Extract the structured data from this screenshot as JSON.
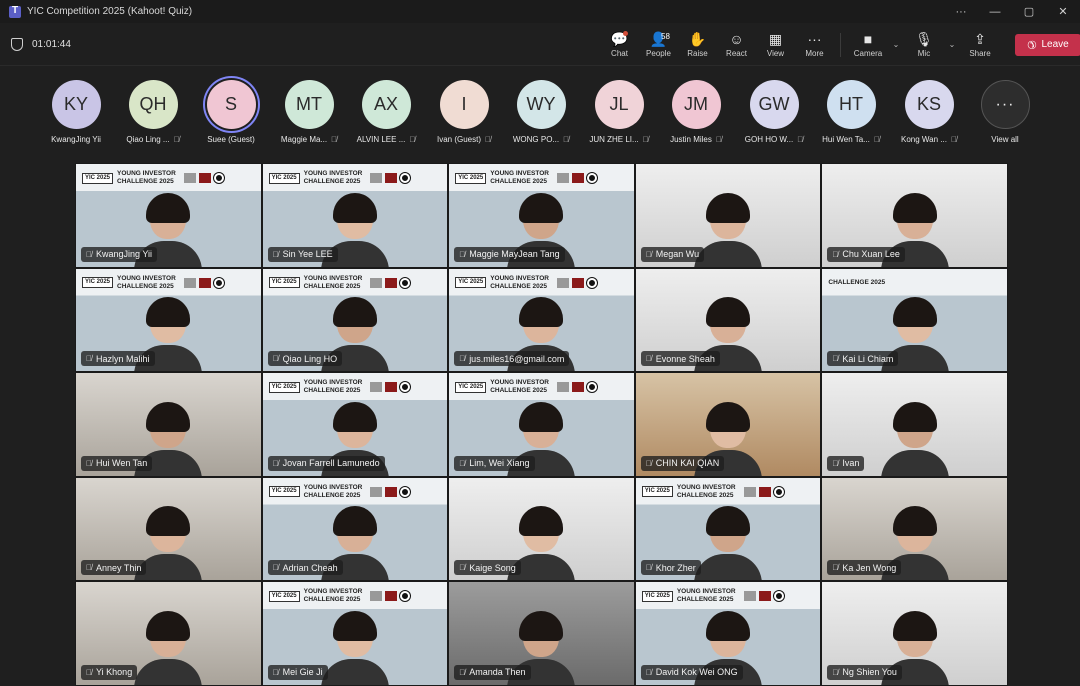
{
  "window": {
    "title": "YIC Competition 2025 (Kahoot! Quiz)",
    "controls": [
      "···",
      "—",
      "▢",
      "✕"
    ]
  },
  "toolbar": {
    "timer": "01:01:44",
    "chat_label": "Chat",
    "people_label": "People",
    "people_count": "58",
    "raise_label": "Raise",
    "react_label": "React",
    "view_label": "View",
    "more_label": "More",
    "camera_label": "Camera",
    "mic_label": "Mic",
    "share_label": "Share",
    "leave_label": "Leave"
  },
  "participants": [
    {
      "initials": "KY",
      "name": "KwangJing Yii",
      "color": "#c9c5e6",
      "muted": false
    },
    {
      "initials": "QH",
      "name": "Qiao Ling ...",
      "color": "#d9e6c8",
      "muted": true
    },
    {
      "initials": "S",
      "name": "Suee (Guest)",
      "color": "#f0c6d3",
      "muted": false,
      "speaking": true
    },
    {
      "initials": "MT",
      "name": "Maggie Ma...",
      "color": "#cfe8d8",
      "muted": true
    },
    {
      "initials": "AX",
      "name": "ALVIN LEE ...",
      "color": "#cfe8d8",
      "muted": true
    },
    {
      "initials": "I",
      "name": "Ivan (Guest)",
      "color": "#f0dcd3",
      "muted": true
    },
    {
      "initials": "WY",
      "name": "WONG PO...",
      "color": "#d3e6e8",
      "muted": true
    },
    {
      "initials": "JL",
      "name": "JUN ZHE LI...",
      "color": "#f0d3d8",
      "muted": true
    },
    {
      "initials": "JM",
      "name": "Justin Miles",
      "color": "#f0c6d3",
      "muted": true
    },
    {
      "initials": "GW",
      "name": "GOH HO W...",
      "color": "#d8d8ee",
      "muted": true
    },
    {
      "initials": "HT",
      "name": "Hui Wen Ta...",
      "color": "#cfe0f0",
      "muted": true
    },
    {
      "initials": "KS",
      "name": "Kong Wan ...",
      "color": "#d8d8ee",
      "muted": true
    }
  ],
  "view_all_label": "View all",
  "banner": {
    "yic": "YIC 2025",
    "line1": "YOUNG INVESTOR",
    "line2": "CHALLENGE 2025",
    "alt": "CHALLENGE 2025"
  },
  "tiles": [
    {
      "name": "KwangJing Yii",
      "bg": "bg-banner",
      "banner": true
    },
    {
      "name": "Sin Yee LEE",
      "bg": "bg-banner",
      "banner": true
    },
    {
      "name": "Maggie MayJean Tang",
      "bg": "bg-banner",
      "banner": true
    },
    {
      "name": "Megan Wu",
      "bg": "bg-white",
      "banner": false
    },
    {
      "name": "Chu Xuan Lee",
      "bg": "bg-white",
      "banner": false
    },
    {
      "name": "Hazlyn Malihi",
      "bg": "bg-banner",
      "banner": true
    },
    {
      "name": "Qiao Ling HO",
      "bg": "bg-banner",
      "banner": true
    },
    {
      "name": "jus.miles16@gmail.com",
      "bg": "bg-banner",
      "banner": true
    },
    {
      "name": "Evonne Sheah",
      "bg": "bg-white",
      "banner": false
    },
    {
      "name": "Kai Li Chiam",
      "bg": "bg-banner",
      "banner": false,
      "alt_banner": true
    },
    {
      "name": "Hui Wen Tan",
      "bg": "bg-room",
      "banner": false
    },
    {
      "name": "Jovan Farrell Lamunedo",
      "bg": "bg-banner",
      "banner": true
    },
    {
      "name": "Lim, Wei Xiang",
      "bg": "bg-banner",
      "banner": true
    },
    {
      "name": "CHIN KAI QIAN",
      "bg": "bg-warm",
      "banner": false
    },
    {
      "name": "Ivan",
      "bg": "bg-white",
      "banner": false
    },
    {
      "name": "Anney Thin",
      "bg": "bg-room",
      "banner": false
    },
    {
      "name": "Adrian Cheah",
      "bg": "bg-banner",
      "banner": true
    },
    {
      "name": "Kaige Song",
      "bg": "bg-white",
      "banner": false
    },
    {
      "name": "Khor Zher",
      "bg": "bg-banner",
      "banner": true
    },
    {
      "name": "Ka Jen Wong",
      "bg": "bg-room",
      "banner": false
    },
    {
      "name": "Yi Khong",
      "bg": "bg-room",
      "banner": false
    },
    {
      "name": "Mei Gie Ji",
      "bg": "bg-banner",
      "banner": true
    },
    {
      "name": "Amanda Then",
      "bg": "bg-dark",
      "banner": false
    },
    {
      "name": "David Kok Wei ONG",
      "bg": "bg-banner",
      "banner": true
    },
    {
      "name": "Ng Shien You",
      "bg": "bg-white",
      "banner": false
    }
  ]
}
